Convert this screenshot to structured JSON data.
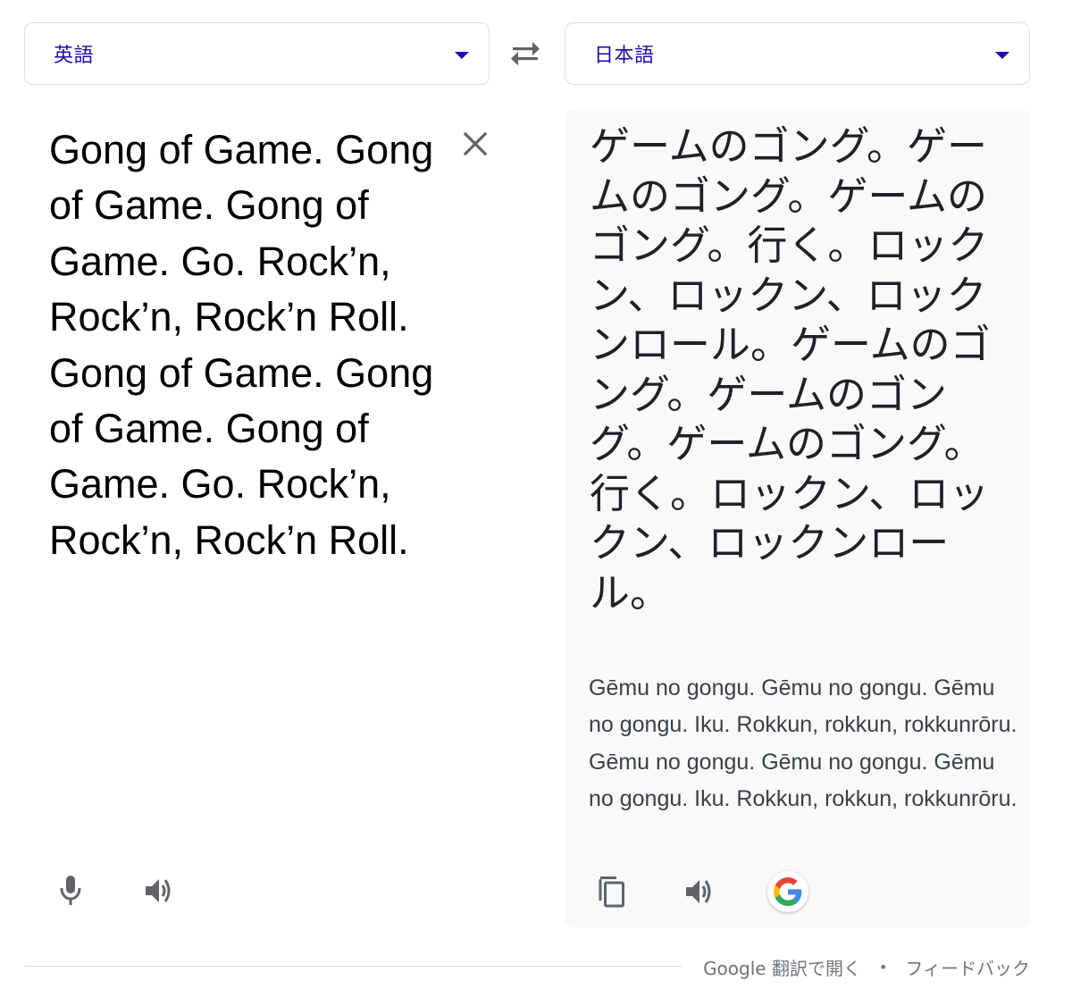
{
  "source_language": {
    "label": "英語"
  },
  "target_language": {
    "label": "日本語"
  },
  "source_text": "Gong of Game. Gong of Game. Gong of Game. Go. Rock’n, Rock’n, Rock’n Roll. Gong of Game. Gong of Game. Gong of Game. Go. Rock’n, Rock’n, Rock’n Roll.",
  "translation": {
    "text": "ゲームのゴング。ゲームのゴング。ゲームのゴング。行く。ロックン、ロックン、ロックンロール。ゲームのゴング。ゲームのゴング。ゲームのゴング。行く。ロックン、ロックン、ロックンロール。",
    "romanization": "Gēmu no gongu. Gēmu no gongu. Gēmu no gongu. Iku. Rokkun, rokkun, rokkunrōru. Gēmu no gongu. Gēmu no gongu. Gēmu no gongu. Iku. Rokkun, rokkun, rokkunrōru."
  },
  "icons": {
    "dropdown": "chevron-down-icon",
    "swap": "swap-icon",
    "clear": "close-icon",
    "mic": "microphone-icon",
    "speaker": "speaker-icon",
    "copy": "copy-icon",
    "google": "google-logo-icon"
  },
  "footer": {
    "open_link": "Google 翻訳で開く",
    "separator": "•",
    "feedback_link": "フィードバック"
  },
  "colors": {
    "accent": "#1a0dab",
    "icon_gray": "#5f6368",
    "panel_bg": "#f8f9fa",
    "border": "#dadce0"
  }
}
